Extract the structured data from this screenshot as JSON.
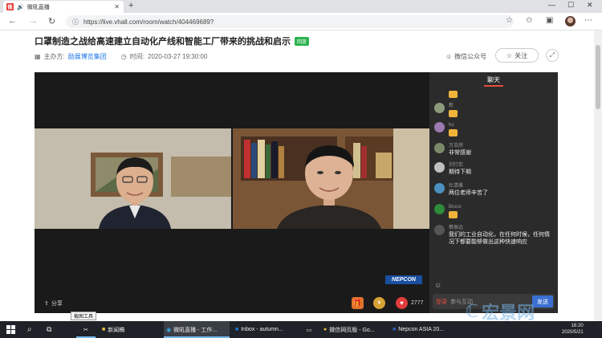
{
  "browser": {
    "tab_title": "微吼直播",
    "tab_favicon": "微",
    "url": "https://live.vhall.com/room/watch/404469689?"
  },
  "page": {
    "title": "口罩制造之战给高速建立自动化产线和智能工厂带来的挑战和启示",
    "badge": "回放",
    "host_label": "主办方:",
    "host_name": "励展博览集团",
    "time_label": "时间:",
    "time_value": "2020-03-27 19:30:00",
    "wechat_label": "微信公众号",
    "follow_label": "关注"
  },
  "player": {
    "share_label": "分享",
    "like_count": "2777",
    "logo_text": "NEPCON"
  },
  "chat": {
    "tab_label": "聊天",
    "messages": [
      {
        "name": "",
        "text": "",
        "thumb": true
      },
      {
        "name": "新",
        "text": "",
        "thumb": true
      },
      {
        "name": "hu",
        "text": "",
        "thumb": true
      },
      {
        "name": "万浩然",
        "text": "非常感谢",
        "thumb": false
      },
      {
        "name": "刘行若",
        "text": "期待下期",
        "thumb": false
      },
      {
        "name": "杜清雅",
        "text": "两位老师辛苦了",
        "thumb": false
      },
      {
        "name": "Bruce",
        "text": "",
        "thumb": true
      },
      {
        "name": "蔡振远",
        "text": "我们的工业自动化，在任何时候，任何情况下都要能够做出这种快速响应",
        "thumb": false
      }
    ],
    "login_link": "登录",
    "input_placeholder": "参与互动",
    "send_label": "发送"
  },
  "taskbar": {
    "tooltip": "截图工具",
    "items": [
      {
        "label": "新闻稿"
      },
      {
        "label": "微吼直播 - 工作..."
      },
      {
        "label": "Inbox - autumn..."
      },
      {
        "label": "微信网页版 - Go..."
      },
      {
        "label": "Nepcon ASIA 20..."
      }
    ],
    "clock_time": "16:20",
    "clock_date": "2020/5/21",
    "watermark": "宏景网"
  }
}
